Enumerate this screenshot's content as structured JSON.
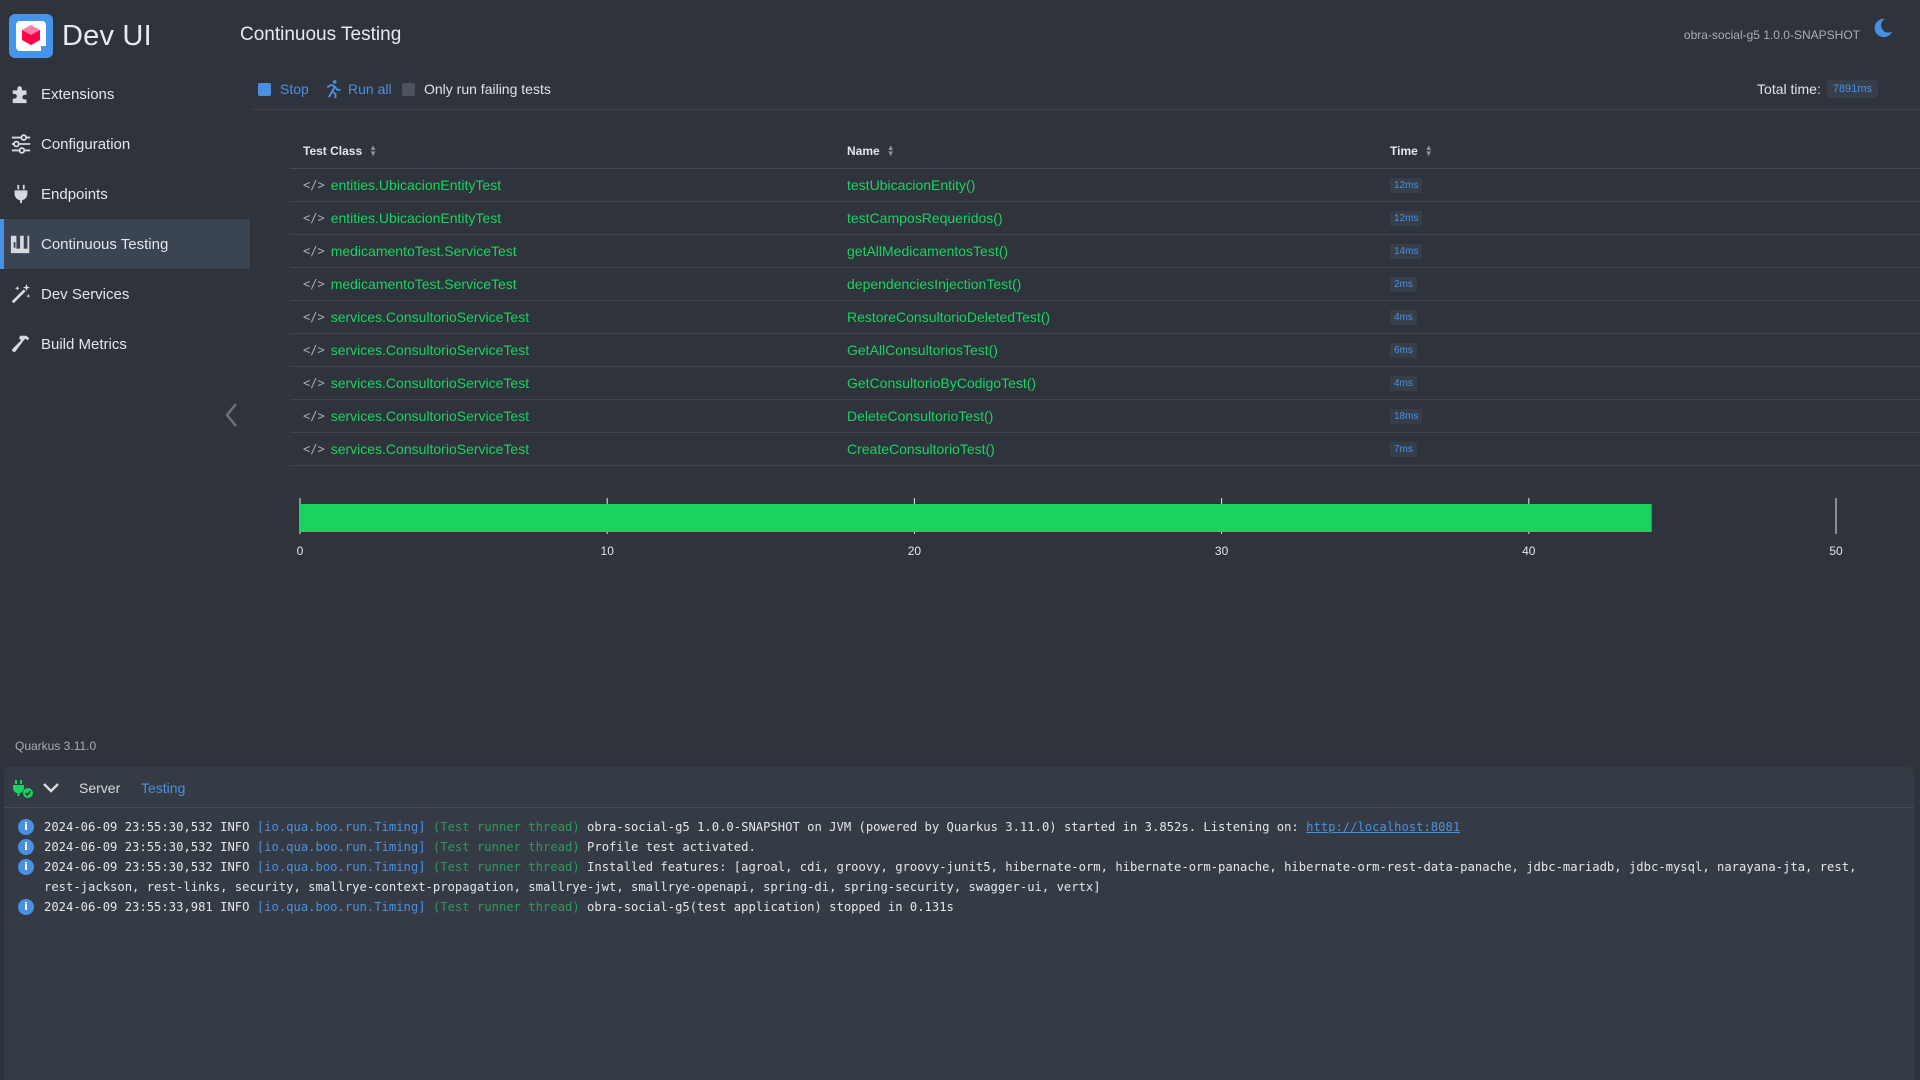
{
  "app": {
    "title": "Dev UI",
    "version": "Quarkus 3.11.0",
    "app_version": "obra-social-g5 1.0.0-SNAPSHOT"
  },
  "sidebar": {
    "items": [
      {
        "label": "Extensions",
        "icon": "puzzle-icon"
      },
      {
        "label": "Configuration",
        "icon": "sliders-icon"
      },
      {
        "label": "Endpoints",
        "icon": "plug-icon"
      },
      {
        "label": "Continuous Testing",
        "icon": "flask-icon",
        "active": true
      },
      {
        "label": "Dev Services",
        "icon": "wand-icon"
      },
      {
        "label": "Build Metrics",
        "icon": "hammer-icon"
      }
    ]
  },
  "header": {
    "title": "Continuous Testing"
  },
  "toolbar": {
    "stop_label": "Stop",
    "run_all_label": "Run all",
    "only_failing_label": "Only run failing tests",
    "total_time_label": "Total time:",
    "total_time_value": "7891ms"
  },
  "table": {
    "headers": [
      "Test Class",
      "Name",
      "Time"
    ],
    "rows": [
      {
        "cls": "entities.UbicacionEntityTest",
        "name": "testUbicacionEntity()",
        "time": "12ms"
      },
      {
        "cls": "entities.UbicacionEntityTest",
        "name": "testCamposRequeridos()",
        "time": "12ms"
      },
      {
        "cls": "medicamentoTest.ServiceTest",
        "name": "getAllMedicamentosTest()",
        "time": "14ms"
      },
      {
        "cls": "medicamentoTest.ServiceTest",
        "name": "dependenciesInjectionTest()",
        "time": "2ms"
      },
      {
        "cls": "services.ConsultorioServiceTest",
        "name": "RestoreConsultorioDeletedTest()",
        "time": "4ms"
      },
      {
        "cls": "services.ConsultorioServiceTest",
        "name": "GetAllConsultoriosTest()",
        "time": "6ms"
      },
      {
        "cls": "services.ConsultorioServiceTest",
        "name": "GetConsultorioByCodigoTest()",
        "time": "4ms"
      },
      {
        "cls": "services.ConsultorioServiceTest",
        "name": "DeleteConsultorioTest()",
        "time": "18ms"
      },
      {
        "cls": "services.ConsultorioServiceTest",
        "name": "CreateConsultorioTest()",
        "time": "7ms"
      }
    ]
  },
  "chart_data": {
    "type": "bar",
    "orientation": "horizontal",
    "values": [
      44
    ],
    "xlim": [
      0,
      50
    ],
    "ticks": [
      "0",
      "10",
      "20",
      "30",
      "40",
      "50"
    ],
    "color": "#19d360"
  },
  "log": {
    "tabs": [
      "Server",
      "Testing"
    ],
    "active_tab": "Testing",
    "lines": [
      {
        "ts": "2024-06-09 23:55:30,532",
        "level": "INFO",
        "logger": "[io.qua.boo.run.Timing]",
        "thread": "(Test runner thread)",
        "msg": "obra-social-g5 1.0.0-SNAPSHOT on JVM (powered by Quarkus 3.11.0) started in 3.852s. Listening on:",
        "link": "http://localhost:8081"
      },
      {
        "ts": "2024-06-09 23:55:30,532",
        "level": "INFO",
        "logger": "[io.qua.boo.run.Timing]",
        "thread": "(Test runner thread)",
        "msg": "Profile test activated.",
        "link": ""
      },
      {
        "ts": "2024-06-09 23:55:30,532",
        "level": "INFO",
        "logger": "[io.qua.boo.run.Timing]",
        "thread": "(Test runner thread)",
        "msg": "Installed features: [agroal, cdi, groovy, groovy-junit5, hibernate-orm, hibernate-orm-panache, hibernate-orm-rest-data-panache, jdbc-mariadb, jdbc-mysql, narayana-jta, rest, rest-jackson, rest-links, security, smallrye-context-propagation, smallrye-jwt, smallrye-openapi, spring-di, spring-security, swagger-ui, vertx]",
        "link": ""
      },
      {
        "ts": "2024-06-09 23:55:33,981",
        "level": "INFO",
        "logger": "[io.qua.boo.run.Timing]",
        "thread": "(Test runner thread)",
        "msg": "obra-social-g5(test application) stopped in 0.131s",
        "link": ""
      }
    ]
  }
}
